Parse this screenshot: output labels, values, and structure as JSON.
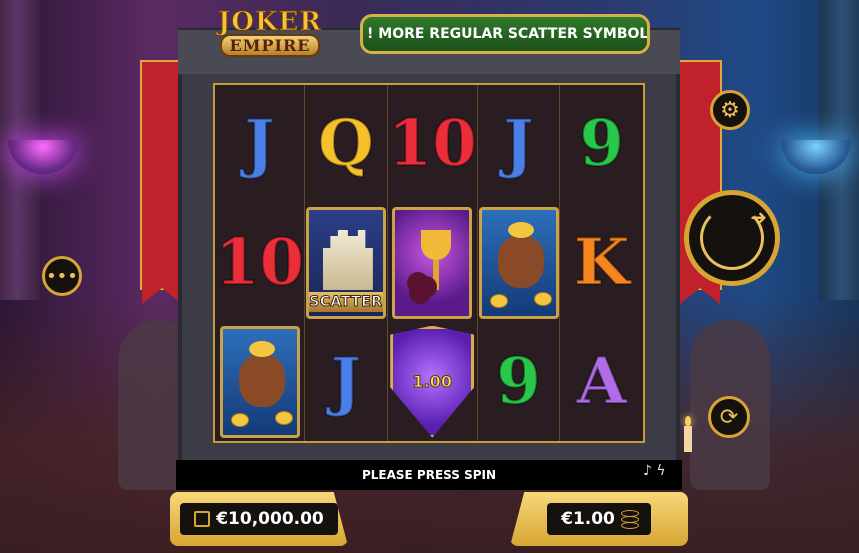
{
  "logo": {
    "line1": "JOKER",
    "line2": "EMPIRE"
  },
  "ticker": {
    "text": "! MORE REGULAR SCATTER SYMBOLS TRIGGER F"
  },
  "reels": [
    [
      "J",
      "Q",
      "10",
      "J",
      "9"
    ],
    [
      "10",
      "scatter",
      "goblet",
      "money-bag",
      "K"
    ],
    [
      "money-bag",
      "J",
      "shield",
      "9",
      "A"
    ]
  ],
  "symbols": {
    "scatter_label": "SCATTER",
    "shield_value": "1.00"
  },
  "message": {
    "text": "PLEASE PRESS SPIN"
  },
  "balance": {
    "value": "€10,000.00"
  },
  "bet": {
    "value": "€1.00"
  },
  "buttons": {
    "spin": "spin-icon",
    "settings": "gear-icon",
    "autoplay": "autoplay-icon",
    "menu": "menu-icon"
  },
  "colors": {
    "accent": "#d7a533",
    "ticker": "#2f7a2b"
  }
}
